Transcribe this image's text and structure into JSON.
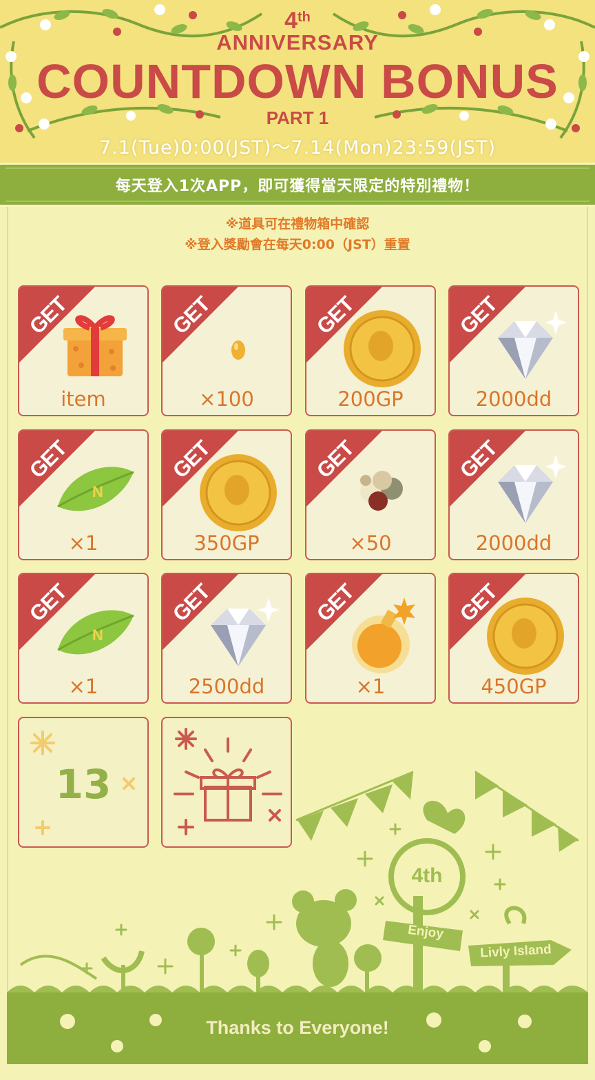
{
  "header": {
    "badge_num": "4",
    "badge_suffix": "th",
    "anniversary": "ANNIVERSARY",
    "title": "COUNTDOWN BONUS",
    "part": "PART 1",
    "date_range": "7.1(Tue)0:00(JST)～7.14(Mon)23:59(JST)"
  },
  "banner": {
    "text": "每天登入1次APP，即可獲得當天限定的特別禮物！"
  },
  "notes": {
    "line1": "※道具可在禮物箱中確認",
    "line2": "※登入獎勵會在每天0:00（JST）重置"
  },
  "ribbon_label": "GET",
  "rewards": [
    {
      "icon": "gift-box-icon",
      "label": "item",
      "claimed": true
    },
    {
      "icon": "gold-drop-icon",
      "label": "×100",
      "claimed": true
    },
    {
      "icon": "gold-coin-icon",
      "label": "200GP",
      "claimed": true
    },
    {
      "icon": "diamond-icon",
      "label": "2000dd",
      "claimed": true
    },
    {
      "icon": "normal-leaf-icon",
      "label": "×1",
      "claimed": true
    },
    {
      "icon": "gold-coin-icon",
      "label": "350GP",
      "claimed": true
    },
    {
      "icon": "seed-pile-icon",
      "label": "×50",
      "claimed": true
    },
    {
      "icon": "diamond-icon",
      "label": "2000dd",
      "claimed": true
    },
    {
      "icon": "normal-leaf-icon",
      "label": "×1",
      "claimed": true
    },
    {
      "icon": "diamond-icon",
      "label": "2500dd",
      "claimed": true
    },
    {
      "icon": "potion-icon",
      "label": "×1",
      "claimed": true
    },
    {
      "icon": "gold-coin-icon",
      "label": "450GP",
      "claimed": true
    }
  ],
  "day13": {
    "value": "13"
  },
  "mystery": {
    "icon": "mystery-gift-icon"
  },
  "footer": {
    "sign_4th": "4th",
    "sign_enjoy": "Enjoy",
    "sign_island": "Livly Island",
    "thanks": "Thanks to Everyone!"
  },
  "colors": {
    "background": "#f5f2b6",
    "header": "#f3e27e",
    "accent_red": "#c94a47",
    "green": "#8eae3e",
    "orange_text": "#d9762a"
  }
}
